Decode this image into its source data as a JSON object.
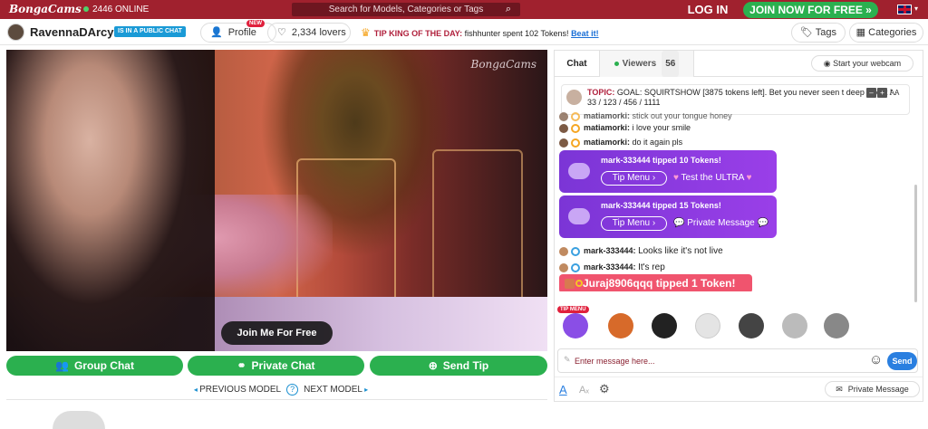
{
  "topbar": {
    "logo": "BongaCams",
    "online": "2446 ONLINE",
    "search_placeholder": "Search for Models, Categories or Tags",
    "login": "LOG IN",
    "join": "JOIN NOW FOR FREE »",
    "language_flag": "uk-flag-icon"
  },
  "model": {
    "name": "RavennaDArcy",
    "status_badge": "IS IN A PUBLIC CHAT",
    "profile_label": "Profile",
    "profile_badge": "NEW",
    "lovers": "2,334 lovers"
  },
  "tip_king": {
    "label": "TIP KING OF THE DAY:",
    "text": "fishhunter spent 102 Tokens!",
    "beat": "Beat it!"
  },
  "nav": {
    "tags": "Tags",
    "categories": "Categories"
  },
  "video": {
    "watermark": "BongaCams",
    "join_free": "Join Me For Free"
  },
  "actions": {
    "group_chat": "Group Chat",
    "private_chat": "Private Chat",
    "send_tip": "Send Tip"
  },
  "model_nav": {
    "previous": "PREVIOUS MODEL",
    "help": "?",
    "next": "NEXT MODEL"
  },
  "chat": {
    "tab_chat": "Chat",
    "tab_viewers": "Viewers",
    "viewers_count": "56",
    "start_webcam": "Start your webcam",
    "topic_label": "TOPIC:",
    "topic_text": "GOAL: SQUIRTSHOW [3875 tokens left]. Bet you never seen t deep throat ! . 33 / 123 / 456 / 1111",
    "topic_controls": [
      "–",
      "+",
      "AA"
    ],
    "messages": [
      {
        "user": "matiamorki:",
        "text": "stick out your tongue honey"
      },
      {
        "user": "matiamorki:",
        "text": "i love your smile"
      },
      {
        "user": "matiamorki:",
        "text": "do it again pls"
      }
    ],
    "tips": [
      {
        "text": "mark-333444 tipped 10 Tokens!",
        "menu": "Tip Menu ›",
        "action": "Test the ULTRA"
      },
      {
        "text": "mark-333444 tipped 15 Tokens!",
        "menu": "Tip Menu ›",
        "action": "Private Message"
      }
    ],
    "messages2": [
      {
        "user": "mark-333444:",
        "text": "Looks like it's not live"
      },
      {
        "user": "mark-333444:",
        "text": "It's rep"
      }
    ],
    "token_tip": "Juraj8906qqq tipped 1 Token!",
    "tip_menu_label": "TIP MENU",
    "games": [
      "gamepad-icon",
      "wheel-icon",
      "record-icon",
      "dice-icon",
      "slots-icon",
      "ball-icon",
      "vibrator-icon"
    ],
    "input_placeholder": "Enter message here...",
    "send": "Send",
    "private_message": "Private Message"
  }
}
